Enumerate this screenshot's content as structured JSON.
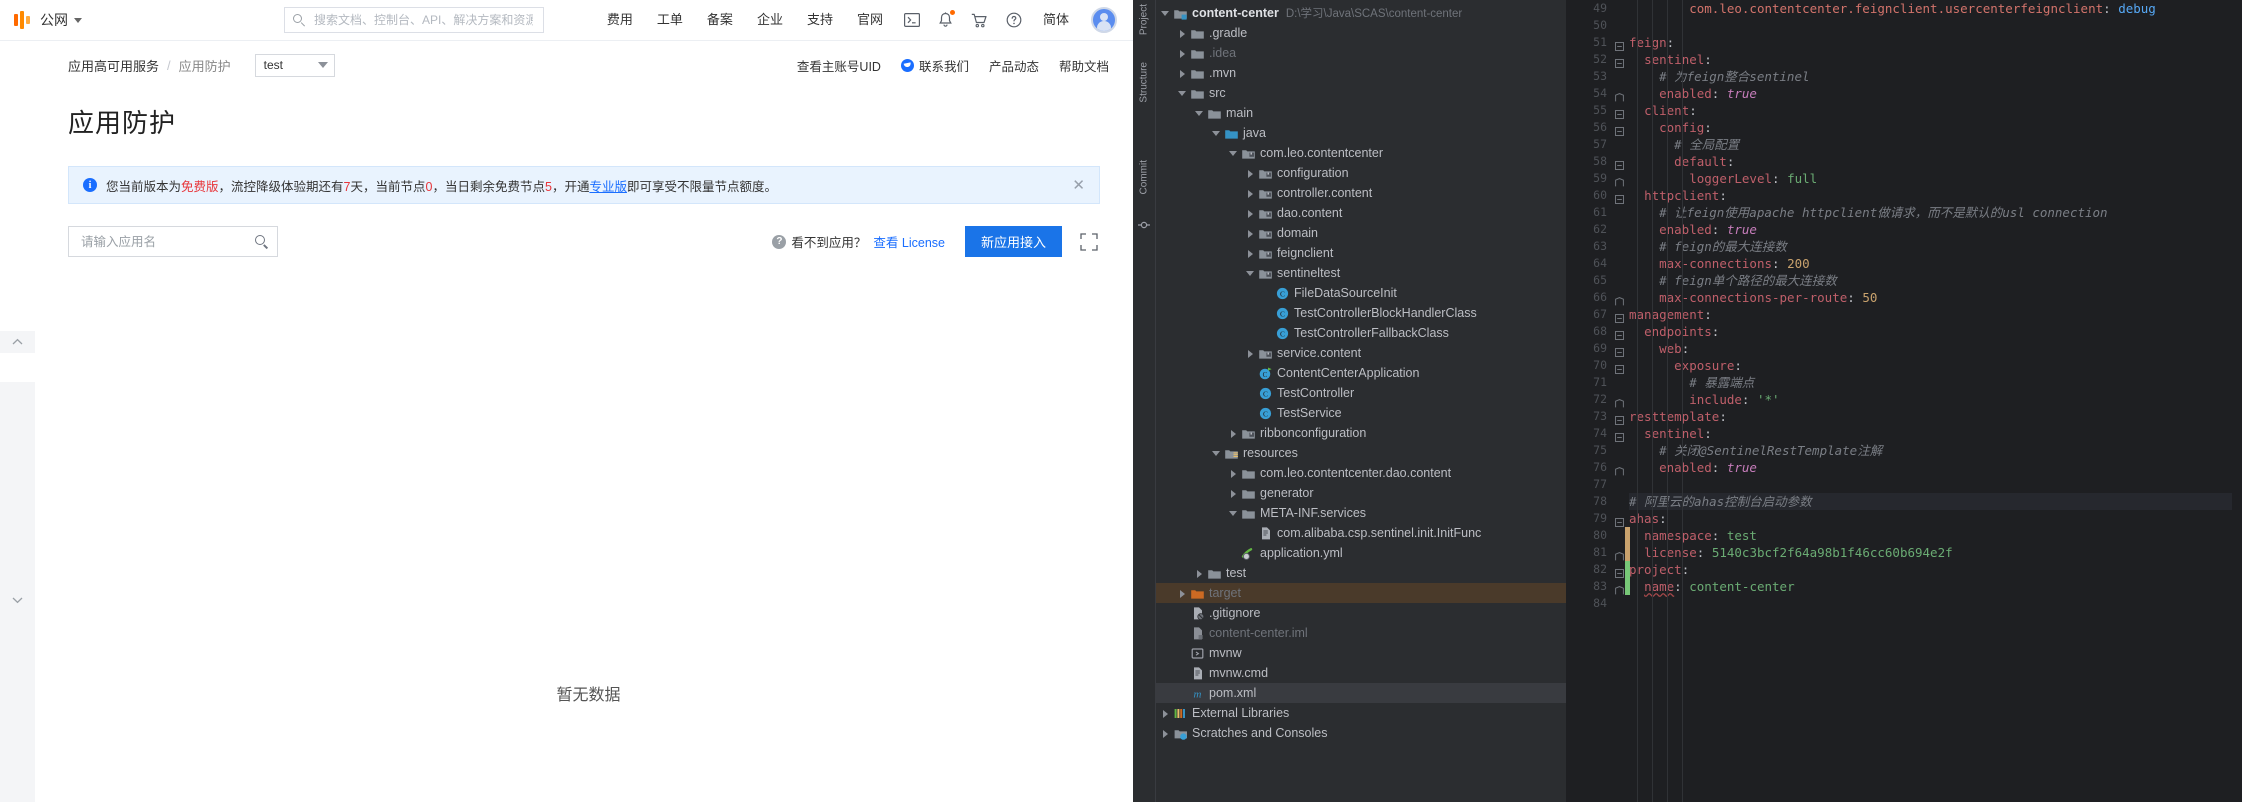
{
  "console": {
    "topbar": {
      "network_label": "公网",
      "search_placeholder": "搜索文档、控制台、API、解决方案和资源",
      "nav": [
        {
          "label": "费用"
        },
        {
          "label": "工单"
        },
        {
          "label": "备案"
        },
        {
          "label": "企业"
        },
        {
          "label": "支持"
        },
        {
          "label": "官网"
        }
      ],
      "icons": [
        "terminal-icon",
        "bell-icon",
        "cart-icon",
        "help-icon"
      ],
      "language_label": "简体"
    },
    "breadcrumb": {
      "parent": "应用高可用服务",
      "sep": "/",
      "current": "应用防护",
      "app_selector_value": "test"
    },
    "header_links": [
      {
        "label": "查看主账号UID",
        "icon": ""
      },
      {
        "label": "联系我们",
        "icon": "contact-icon"
      },
      {
        "label": "产品动态",
        "icon": ""
      },
      {
        "label": "帮助文档",
        "icon": ""
      }
    ],
    "page_title": "应用防护",
    "notice": {
      "icon": "info-icon",
      "p1": "您当前版本为",
      "free_edition": "免费版",
      "p2": "，流控降级体验期还有",
      "days": "7",
      "p3": "天，当前节点",
      "nodes": "0",
      "p4": "，当日剩余免费节点",
      "free_nodes": "5",
      "p5": "，开通",
      "pro_edition": "专业版",
      "p6": "即可享受不限量节点额度。",
      "close_label": "✕"
    },
    "toolbar": {
      "search_placeholder": "请输入应用名",
      "search_value": "",
      "hint_text": "看不到应用？",
      "hint_link": "查看 License",
      "primary_button": "新应用接入",
      "expand_icon": "fullscreen-icon"
    },
    "empty_state": "暂无数据"
  },
  "ide": {
    "strips": [
      {
        "label": "Project"
      },
      {
        "label": "Structure"
      },
      {
        "label": "Commit"
      }
    ],
    "tree": [
      {
        "depth": 0,
        "arrow": "d",
        "icon": "module-folder",
        "label": "content-center",
        "path": "D:\\学习\\Java\\SCAS\\content-center",
        "style": "bold"
      },
      {
        "depth": 1,
        "arrow": "r",
        "icon": "folder",
        "label": ".gradle",
        "path": "",
        "style": ""
      },
      {
        "depth": 1,
        "arrow": "r",
        "icon": "folder",
        "label": ".idea",
        "path": "",
        "style": "dim"
      },
      {
        "depth": 1,
        "arrow": "r",
        "icon": "folder",
        "label": ".mvn",
        "path": "",
        "style": ""
      },
      {
        "depth": 1,
        "arrow": "d",
        "icon": "folder",
        "label": "src",
        "path": "",
        "style": ""
      },
      {
        "depth": 2,
        "arrow": "d",
        "icon": "folder",
        "label": "main",
        "path": "",
        "style": ""
      },
      {
        "depth": 3,
        "arrow": "d",
        "icon": "source-folder",
        "label": "java",
        "path": "",
        "style": ""
      },
      {
        "depth": 4,
        "arrow": "d",
        "icon": "package",
        "label": "com.leo.contentcenter",
        "path": "",
        "style": ""
      },
      {
        "depth": 5,
        "arrow": "r",
        "icon": "package",
        "label": "configuration",
        "path": "",
        "style": ""
      },
      {
        "depth": 5,
        "arrow": "r",
        "icon": "package",
        "label": "controller.content",
        "path": "",
        "style": ""
      },
      {
        "depth": 5,
        "arrow": "r",
        "icon": "package",
        "label": "dao.content",
        "path": "",
        "style": ""
      },
      {
        "depth": 5,
        "arrow": "r",
        "icon": "package",
        "label": "domain",
        "path": "",
        "style": ""
      },
      {
        "depth": 5,
        "arrow": "r",
        "icon": "package",
        "label": "feignclient",
        "path": "",
        "style": ""
      },
      {
        "depth": 5,
        "arrow": "d",
        "icon": "package",
        "label": "sentineltest",
        "path": "",
        "style": ""
      },
      {
        "depth": 6,
        "arrow": "",
        "icon": "class",
        "label": "FileDataSourceInit",
        "path": "",
        "style": "cls"
      },
      {
        "depth": 6,
        "arrow": "",
        "icon": "class",
        "label": "TestControllerBlockHandlerClass",
        "path": "",
        "style": "cls"
      },
      {
        "depth": 6,
        "arrow": "",
        "icon": "class",
        "label": "TestControllerFallbackClass",
        "path": "",
        "style": "cls"
      },
      {
        "depth": 5,
        "arrow": "r",
        "icon": "package",
        "label": "service.content",
        "path": "",
        "style": ""
      },
      {
        "depth": 5,
        "arrow": "",
        "icon": "spring-class",
        "label": "ContentCenterApplication",
        "path": "",
        "style": "cls"
      },
      {
        "depth": 5,
        "arrow": "",
        "icon": "class",
        "label": "TestController",
        "path": "",
        "style": "cls"
      },
      {
        "depth": 5,
        "arrow": "",
        "icon": "class",
        "label": "TestService",
        "path": "",
        "style": "cls"
      },
      {
        "depth": 4,
        "arrow": "r",
        "icon": "package",
        "label": "ribbonconfiguration",
        "path": "",
        "style": ""
      },
      {
        "depth": 3,
        "arrow": "d",
        "icon": "resources-folder",
        "label": "resources",
        "path": "",
        "style": ""
      },
      {
        "depth": 4,
        "arrow": "r",
        "icon": "folder",
        "label": "com.leo.contentcenter.dao.content",
        "path": "",
        "style": ""
      },
      {
        "depth": 4,
        "arrow": "r",
        "icon": "folder",
        "label": "generator",
        "path": "",
        "style": ""
      },
      {
        "depth": 4,
        "arrow": "d",
        "icon": "folder",
        "label": "META-INF.services",
        "path": "",
        "style": ""
      },
      {
        "depth": 5,
        "arrow": "",
        "icon": "file",
        "label": "com.alibaba.csp.sentinel.init.InitFunc",
        "path": "",
        "style": ""
      },
      {
        "depth": 4,
        "arrow": "",
        "icon": "yml",
        "label": "application.yml",
        "path": "",
        "style": ""
      },
      {
        "depth": 2,
        "arrow": "r",
        "icon": "folder",
        "label": "test",
        "path": "",
        "style": ""
      },
      {
        "depth": 1,
        "arrow": "r",
        "icon": "target-folder",
        "label": "target",
        "path": "",
        "style": "target"
      },
      {
        "depth": 1,
        "arrow": "",
        "icon": "gitignore",
        "label": ".gitignore",
        "path": "",
        "style": ""
      },
      {
        "depth": 1,
        "arrow": "",
        "icon": "iml",
        "label": "content-center.iml",
        "path": "",
        "style": "dim"
      },
      {
        "depth": 1,
        "arrow": "",
        "icon": "script",
        "label": "mvnw",
        "path": "",
        "style": ""
      },
      {
        "depth": 1,
        "arrow": "",
        "icon": "file",
        "label": "mvnw.cmd",
        "path": "",
        "style": ""
      },
      {
        "depth": 1,
        "arrow": "",
        "icon": "maven",
        "label": "pom.xml",
        "path": "",
        "style": "selfile"
      },
      {
        "depth": 0,
        "arrow": "r",
        "icon": "libraries",
        "label": "External Libraries",
        "path": "",
        "style": ""
      },
      {
        "depth": 0,
        "arrow": "r",
        "icon": "scratches",
        "label": "Scratches and Consoles",
        "path": "",
        "style": ""
      }
    ],
    "editor": {
      "first_line_number": 49,
      "lines": [
        {
          "n": 49,
          "indent": 4,
          "fold": "",
          "hl": false,
          "segs": [
            {
              "t": "com.leo.contentcenter.feignclient.usercenterfeignclient",
              "c": "kk"
            },
            {
              "t": ": ",
              "c": "p"
            },
            {
              "t": "debug",
              "c": "blue"
            }
          ]
        },
        {
          "n": 50,
          "indent": 0,
          "fold": "",
          "hl": false,
          "segs": []
        },
        {
          "n": 51,
          "indent": 0,
          "fold": "minus",
          "hl": false,
          "segs": [
            {
              "t": "feign",
              "c": "kred"
            },
            {
              "t": ":",
              "c": "p"
            }
          ]
        },
        {
          "n": 52,
          "indent": 1,
          "fold": "minus",
          "hl": false,
          "segs": [
            {
              "t": "sentinel",
              "c": "kred"
            },
            {
              "t": ":",
              "c": "p"
            }
          ]
        },
        {
          "n": 53,
          "indent": 2,
          "fold": "",
          "hl": false,
          "segs": [
            {
              "t": "# 为feign整合sentinel",
              "c": "cm"
            }
          ]
        },
        {
          "n": 54,
          "indent": 2,
          "fold": "end",
          "hl": false,
          "segs": [
            {
              "t": "enabled",
              "c": "kred"
            },
            {
              "t": ": ",
              "c": "p"
            },
            {
              "t": "true",
              "c": "b"
            }
          ]
        },
        {
          "n": 55,
          "indent": 1,
          "fold": "minus",
          "hl": false,
          "segs": [
            {
              "t": "client",
              "c": "kred"
            },
            {
              "t": ":",
              "c": "p"
            }
          ]
        },
        {
          "n": 56,
          "indent": 2,
          "fold": "minus",
          "hl": false,
          "segs": [
            {
              "t": "config",
              "c": "kred"
            },
            {
              "t": ":",
              "c": "p"
            }
          ]
        },
        {
          "n": 57,
          "indent": 3,
          "fold": "",
          "hl": false,
          "segs": [
            {
              "t": "# 全局配置",
              "c": "cm"
            }
          ]
        },
        {
          "n": 58,
          "indent": 3,
          "fold": "minus",
          "hl": false,
          "segs": [
            {
              "t": "default",
              "c": "kred"
            },
            {
              "t": ":",
              "c": "p"
            }
          ]
        },
        {
          "n": 59,
          "indent": 4,
          "fold": "end",
          "hl": false,
          "segs": [
            {
              "t": "loggerLevel",
              "c": "kred"
            },
            {
              "t": ": ",
              "c": "p"
            },
            {
              "t": "full",
              "c": "s"
            }
          ]
        },
        {
          "n": 60,
          "indent": 1,
          "fold": "minus",
          "hl": false,
          "segs": [
            {
              "t": "httpclient",
              "c": "kred"
            },
            {
              "t": ":",
              "c": "p"
            }
          ]
        },
        {
          "n": 61,
          "indent": 2,
          "fold": "",
          "hl": false,
          "segs": [
            {
              "t": "# 让feign使用apache httpclient做请求，而不是默认的usl connection",
              "c": "cm"
            }
          ]
        },
        {
          "n": 62,
          "indent": 2,
          "fold": "",
          "hl": false,
          "segs": [
            {
              "t": "enabled",
              "c": "kred"
            },
            {
              "t": ": ",
              "c": "p"
            },
            {
              "t": "true",
              "c": "b"
            }
          ]
        },
        {
          "n": 63,
          "indent": 2,
          "fold": "",
          "hl": false,
          "segs": [
            {
              "t": "# feign的最大连接数",
              "c": "cm"
            }
          ]
        },
        {
          "n": 64,
          "indent": 2,
          "fold": "",
          "hl": false,
          "segs": [
            {
              "t": "max-connections",
              "c": "kred"
            },
            {
              "t": ": ",
              "c": "p"
            },
            {
              "t": "200",
              "c": "num"
            }
          ]
        },
        {
          "n": 65,
          "indent": 2,
          "fold": "",
          "hl": false,
          "segs": [
            {
              "t": "# feign单个路径的最大连接数",
              "c": "cm"
            }
          ]
        },
        {
          "n": 66,
          "indent": 2,
          "fold": "end",
          "hl": false,
          "segs": [
            {
              "t": "max-connections-per-route",
              "c": "kred"
            },
            {
              "t": ": ",
              "c": "p"
            },
            {
              "t": "50",
              "c": "num"
            }
          ]
        },
        {
          "n": 67,
          "indent": 0,
          "fold": "minus",
          "hl": false,
          "segs": [
            {
              "t": "management",
              "c": "kred"
            },
            {
              "t": ":",
              "c": "p"
            }
          ]
        },
        {
          "n": 68,
          "indent": 1,
          "fold": "minus",
          "hl": false,
          "segs": [
            {
              "t": "endpoints",
              "c": "kred"
            },
            {
              "t": ":",
              "c": "p"
            }
          ]
        },
        {
          "n": 69,
          "indent": 2,
          "fold": "minus",
          "hl": false,
          "segs": [
            {
              "t": "web",
              "c": "kred"
            },
            {
              "t": ":",
              "c": "p"
            }
          ]
        },
        {
          "n": 70,
          "indent": 3,
          "fold": "minus",
          "hl": false,
          "segs": [
            {
              "t": "exposure",
              "c": "kred"
            },
            {
              "t": ":",
              "c": "p"
            }
          ]
        },
        {
          "n": 71,
          "indent": 4,
          "fold": "",
          "hl": false,
          "segs": [
            {
              "t": "# 暴露端点",
              "c": "cm"
            }
          ]
        },
        {
          "n": 72,
          "indent": 4,
          "fold": "end",
          "hl": false,
          "segs": [
            {
              "t": "include",
              "c": "kred"
            },
            {
              "t": ": ",
              "c": "p"
            },
            {
              "t": "'*'",
              "c": "s"
            }
          ]
        },
        {
          "n": 73,
          "indent": 0,
          "fold": "minus",
          "hl": false,
          "segs": [
            {
              "t": "resttemplate",
              "c": "kred"
            },
            {
              "t": ":",
              "c": "p"
            }
          ]
        },
        {
          "n": 74,
          "indent": 1,
          "fold": "minus",
          "hl": false,
          "segs": [
            {
              "t": "sentinel",
              "c": "kred"
            },
            {
              "t": ":",
              "c": "p"
            }
          ]
        },
        {
          "n": 75,
          "indent": 2,
          "fold": "",
          "hl": false,
          "segs": [
            {
              "t": "# 关闭@SentinelRestTemplate注解",
              "c": "cm"
            }
          ]
        },
        {
          "n": 76,
          "indent": 2,
          "fold": "end",
          "hl": false,
          "segs": [
            {
              "t": "enabled",
              "c": "kred"
            },
            {
              "t": ": ",
              "c": "p"
            },
            {
              "t": "true",
              "c": "b"
            }
          ]
        },
        {
          "n": 77,
          "indent": 0,
          "fold": "",
          "hl": false,
          "segs": []
        },
        {
          "n": 78,
          "indent": 0,
          "fold": "",
          "hl": true,
          "segs": [
            {
              "t": "# 阿里云的ahas控制台启动参数",
              "c": "cm"
            }
          ]
        },
        {
          "n": 79,
          "indent": 0,
          "fold": "minus",
          "hl": false,
          "segs": [
            {
              "t": "ahas",
              "c": "kred"
            },
            {
              "t": ":",
              "c": "p"
            }
          ]
        },
        {
          "n": 80,
          "indent": 1,
          "fold": "",
          "hl": false,
          "segs": [
            {
              "t": "namespace",
              "c": "kred"
            },
            {
              "t": ": ",
              "c": "p"
            },
            {
              "t": "test",
              "c": "s"
            }
          ]
        },
        {
          "n": 81,
          "indent": 1,
          "fold": "end",
          "hl": false,
          "segs": [
            {
              "t": "license",
              "c": "kred"
            },
            {
              "t": ": ",
              "c": "p"
            },
            {
              "t": "5140c3bcf2f64a98b1f46cc60b694e2f",
              "c": "s"
            }
          ]
        },
        {
          "n": 82,
          "indent": 0,
          "fold": "minus",
          "hl": false,
          "segs": [
            {
              "t": "project",
              "c": "kred"
            },
            {
              "t": ":",
              "c": "p"
            }
          ]
        },
        {
          "n": 83,
          "indent": 1,
          "fold": "end",
          "hl": false,
          "segs": [
            {
              "t": "name",
              "c": "kred",
              "wavy": true
            },
            {
              "t": ": ",
              "c": "p"
            },
            {
              "t": "content-center",
              "c": "s"
            }
          ]
        },
        {
          "n": 84,
          "indent": 0,
          "fold": "",
          "hl": false,
          "segs": []
        }
      ]
    }
  }
}
